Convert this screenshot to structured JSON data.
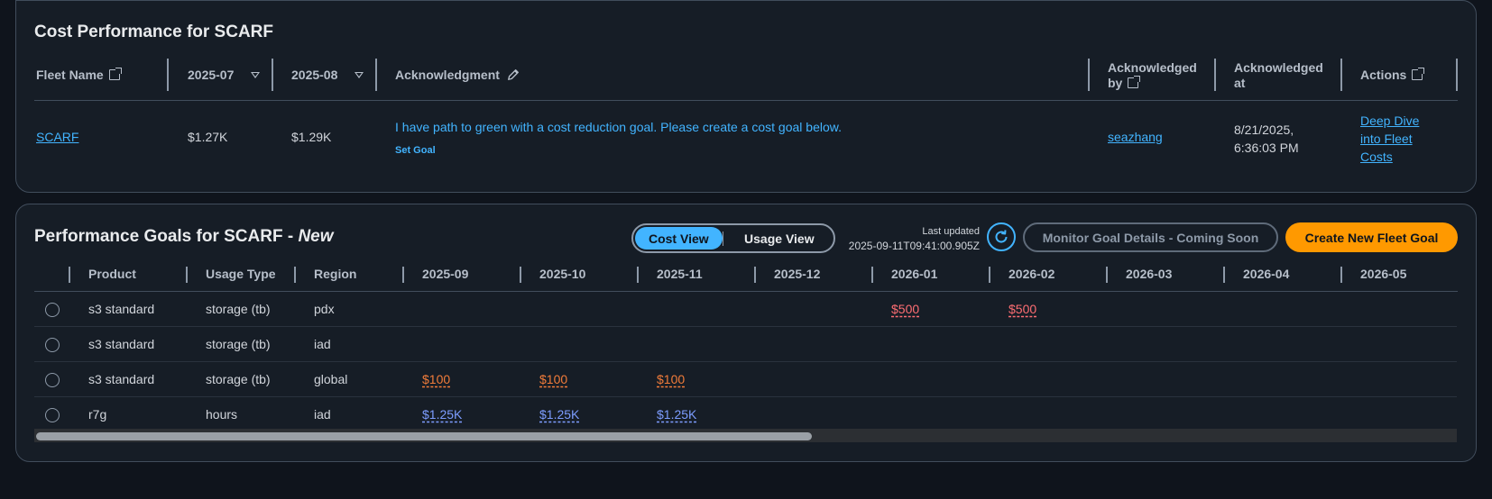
{
  "cost_performance": {
    "title": "Cost Performance for SCARF",
    "columns": {
      "fleet_name": "Fleet Name",
      "month1": "2025-07",
      "month2": "2025-08",
      "acknowledgment": "Acknowledgment",
      "acknowledged_by_line1": "Acknowledged",
      "acknowledged_by_line2": "by",
      "acknowledged_at_line1": "Acknowledged",
      "acknowledged_at_line2": "at",
      "actions": "Actions"
    },
    "row": {
      "fleet_name": "SCARF",
      "month1": "$1.27K",
      "month2": "$1.29K",
      "acknowledgment_text": "I have path to green with a cost reduction goal. Please create a cost goal below.",
      "set_goal": "Set Goal",
      "acknowledged_by": "seazhang",
      "acknowledged_at_line1": "8/21/2025,",
      "acknowledged_at_line2": "6:36:03 PM",
      "action_line1": "Deep Dive",
      "action_line2": "into Fleet",
      "action_line3": "Costs"
    }
  },
  "performance_goals": {
    "title_prefix": "Performance Goals for SCARF - ",
    "title_suffix": "New",
    "view_toggle": {
      "cost": "Cost View",
      "usage": "Usage View",
      "selected": "Cost View"
    },
    "last_updated_label": "Last updated",
    "last_updated_value": "2025-09-11T09:41:00.905Z",
    "monitor_button": "Monitor Goal Details - Coming Soon",
    "create_button": "Create New Fleet Goal",
    "columns": [
      "Product",
      "Usage Type",
      "Region",
      "2025-09",
      "2025-10",
      "2025-11",
      "2025-12",
      "2026-01",
      "2026-02",
      "2026-03",
      "2026-04",
      "2026-05"
    ],
    "rows": [
      {
        "product": "s3 standard",
        "usage_type": "storage (tb)",
        "region": "pdx",
        "values": [
          "",
          "",
          "",
          "",
          "$500",
          "$500",
          "",
          "",
          ""
        ]
      },
      {
        "product": "s3 standard",
        "usage_type": "storage (tb)",
        "region": "iad",
        "values": [
          "",
          "",
          "",
          "",
          "",
          "",
          "",
          "",
          ""
        ]
      },
      {
        "product": "s3 standard",
        "usage_type": "storage (tb)",
        "region": "global",
        "values": [
          "$100",
          "$100",
          "$100",
          "",
          "",
          "",
          "",
          "",
          ""
        ]
      },
      {
        "product": "r7g",
        "usage_type": "hours",
        "region": "iad",
        "values": [
          "$1.25K",
          "$1.25K",
          "$1.25K",
          "",
          "",
          "",
          "",
          "",
          ""
        ]
      }
    ]
  },
  "colors": {
    "accent": "#42b4ff",
    "primary_button": "#ff9900",
    "value_red": "#fe6e73",
    "value_orange": "#f27c3a",
    "value_blue": "#7d9dff"
  }
}
